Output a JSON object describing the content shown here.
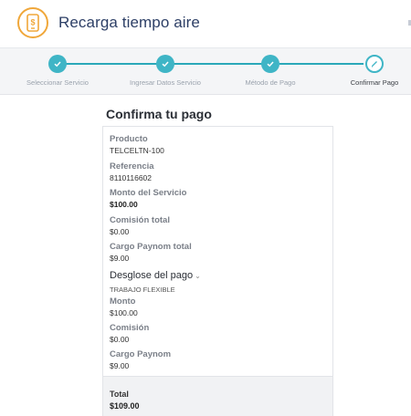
{
  "header": {
    "title": "Recarga tiempo aire",
    "icon": "mobile-dollar-icon",
    "accent": "#f0a73a"
  },
  "stepper": {
    "color": "#3fb5c6",
    "steps": [
      {
        "label": "Seleccionar Servicio",
        "state": "done"
      },
      {
        "label": "Ingresar Datos Servicio",
        "state": "done"
      },
      {
        "label": "Método de Pago",
        "state": "done"
      },
      {
        "label": "Confirmar Pago",
        "state": "current"
      }
    ]
  },
  "main": {
    "title": "Confirma tu pago",
    "fields": [
      {
        "label": "Producto",
        "value": "TELCELTN-100"
      },
      {
        "label": "Referencia",
        "value": "8110116602"
      },
      {
        "label": "Monto del Servicio",
        "value": "$100.00"
      },
      {
        "label": "Comisión total",
        "value": "$0.00"
      },
      {
        "label": "Cargo Paynom total",
        "value": "$9.00"
      }
    ],
    "breakdown": {
      "title": "Desglose del pago",
      "subtitle": "TRABAJO FLEXIBLE",
      "fields": [
        {
          "label": "Monto",
          "value": "$100.00"
        },
        {
          "label": "Comisión",
          "value": "$0.00"
        },
        {
          "label": "Cargo Paynom",
          "value": "$9.00"
        }
      ]
    },
    "total": {
      "label": "Total",
      "value": "$109.00"
    }
  }
}
